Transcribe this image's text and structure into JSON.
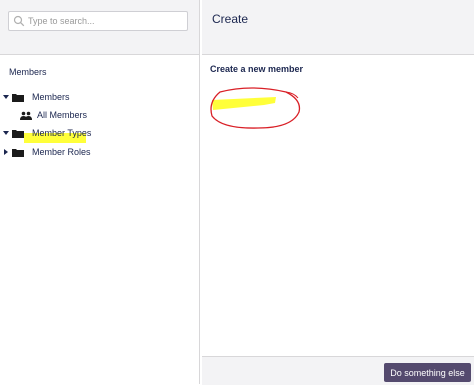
{
  "search": {
    "placeholder": "Type to search..."
  },
  "tree": {
    "section_title": "Members",
    "items": [
      {
        "label": "Members",
        "icon": "folder-icon"
      },
      {
        "label": "All Members",
        "icon": "people-icon"
      },
      {
        "label": "Member Types",
        "icon": "folder-icon"
      },
      {
        "label": "Member Roles",
        "icon": "folder-icon"
      }
    ]
  },
  "main": {
    "title": "Create",
    "subheading": "Create a new member"
  },
  "footer": {
    "action_label": "Do something else"
  },
  "colors": {
    "accent": "#544a6e",
    "highlight": "#ffff3a",
    "annotation": "#d91f26",
    "text": "#1b264f"
  }
}
